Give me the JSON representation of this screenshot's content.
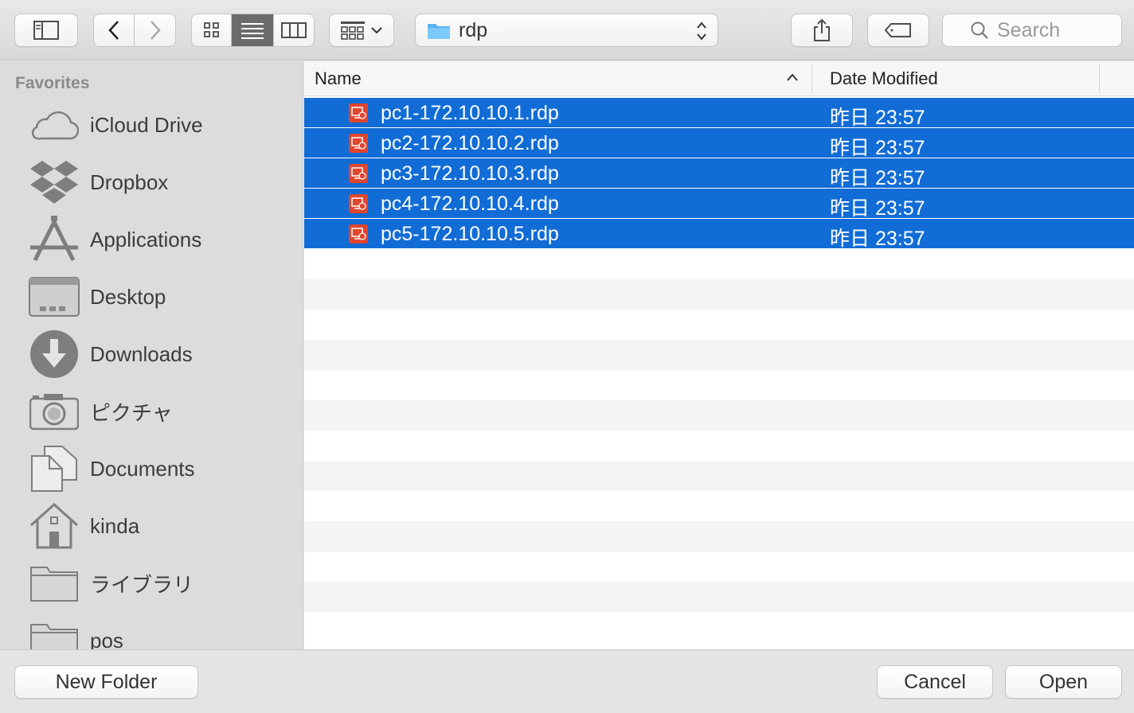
{
  "toolbar": {
    "path_label": "rdp",
    "search_placeholder": "Search"
  },
  "sidebar": {
    "heading": "Favorites",
    "items": [
      {
        "label": "iCloud Drive",
        "icon": "cloud-icon"
      },
      {
        "label": "Dropbox",
        "icon": "dropbox-icon"
      },
      {
        "label": "Applications",
        "icon": "applications-icon"
      },
      {
        "label": "Desktop",
        "icon": "desktop-icon"
      },
      {
        "label": "Downloads",
        "icon": "downloads-icon"
      },
      {
        "label": "ピクチャ",
        "icon": "camera-icon"
      },
      {
        "label": "Documents",
        "icon": "documents-icon"
      },
      {
        "label": "kinda",
        "icon": "home-icon"
      },
      {
        "label": "ライブラリ",
        "icon": "folder-icon"
      },
      {
        "label": "pos",
        "icon": "folder-icon"
      }
    ]
  },
  "columns": {
    "name": "Name",
    "date": "Date Modified"
  },
  "files": [
    {
      "name": "pc1-172.10.10.1.rdp",
      "date": "昨日 23:57",
      "selected": true
    },
    {
      "name": "pc2-172.10.10.2.rdp",
      "date": "昨日 23:57",
      "selected": true
    },
    {
      "name": "pc3-172.10.10.3.rdp",
      "date": "昨日 23:57",
      "selected": true
    },
    {
      "name": "pc4-172.10.10.4.rdp",
      "date": "昨日 23:57",
      "selected": true
    },
    {
      "name": "pc5-172.10.10.5.rdp",
      "date": "昨日 23:57",
      "selected": true
    }
  ],
  "buttons": {
    "new_folder": "New Folder",
    "cancel": "Cancel",
    "open": "Open"
  },
  "colors": {
    "selection": "#116cd6",
    "file_icon": "#e0452e"
  }
}
